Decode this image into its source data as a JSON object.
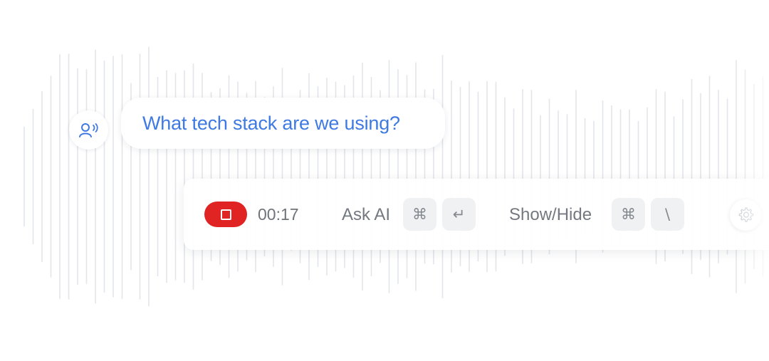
{
  "conversation": {
    "speaker_icon": "speaker-listening-icon",
    "question": "What tech stack are we using?"
  },
  "control_bar": {
    "stop_icon": "stop-icon",
    "timer": "00:17",
    "ask_ai": {
      "label": "Ask AI",
      "keys": [
        "⌘",
        "↵"
      ]
    },
    "show_hide": {
      "label": "Show/Hide",
      "keys": [
        "⌘",
        "\\"
      ]
    },
    "settings_icon": "gear-icon"
  },
  "colors": {
    "accent_blue": "#3f7ae3",
    "recording_red": "#e02424",
    "waveform": "#e3e5e9"
  }
}
